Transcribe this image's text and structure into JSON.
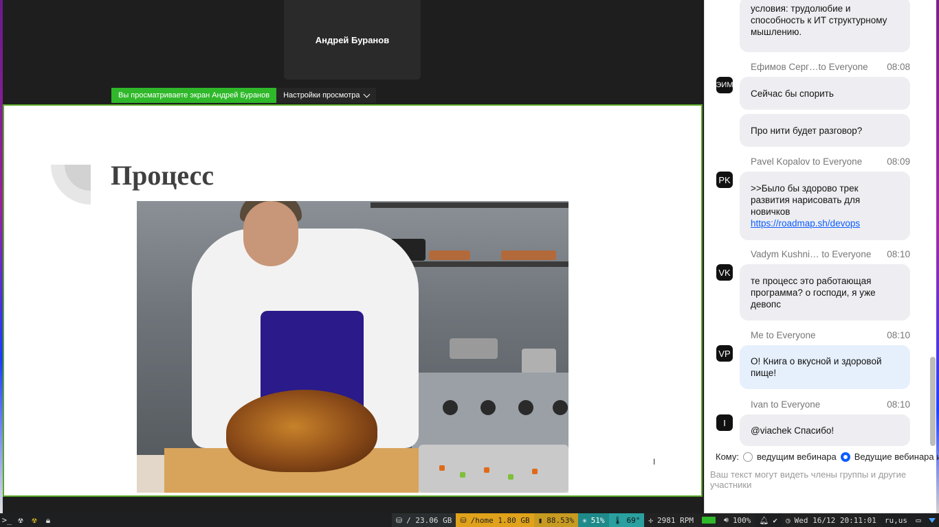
{
  "meeting": {
    "speaker_name": "Андрей Буранов",
    "share_label": "Вы просматриваете экран Андрей Буранов",
    "view_settings_label": "Настройки просмотра"
  },
  "slide": {
    "title": "Процесс"
  },
  "chat": {
    "partial_message": "условия: трудолюбие и способность к ИТ структурному мышлению.",
    "messages": [
      {
        "sender": "Ефимов Серг…to Everyone",
        "time": "08:08",
        "avatar": "ЭИМ",
        "bubbles": [
          "Сейчас бы спорить",
          "Про нити будет разговор?"
        ]
      },
      {
        "sender": "Pavel Kopalov to Everyone",
        "time": "08:09",
        "avatar": "PK",
        "text": ">>Было бы здорово трек развития нарисовать для новичков ",
        "link": "https://roadmap.sh/devops"
      },
      {
        "sender": "Vadym Kushni… to Everyone",
        "time": "08:10",
        "avatar": "VK",
        "text": "те процесс это работающая программа? о господи, я уже девопс"
      },
      {
        "sender": "Me to Everyone",
        "time": "08:10",
        "avatar": "VP",
        "text": "О! Книга о вкусной и здоровой пище!"
      },
      {
        "sender": "Ivan to Everyone",
        "time": "08:10",
        "avatar": "I",
        "text": "@viachek Спасибо!"
      }
    ],
    "to_label": "Кому:",
    "recipient_option_1": "ведущим вебинара",
    "recipient_option_2": "Ведущие вебинара и",
    "selected_recipient": "Ведущие вебинара и",
    "input_placeholder": "Ваш текст могут видеть члены группы и другие участники"
  },
  "taskbar": {
    "disk_root": "/ 23.06 GB",
    "disk_home": "/home 1.80 GB",
    "battery": "88.53%",
    "cpu": "51%",
    "temperature": "69°",
    "fan": "2981 RPM",
    "volume": "100%",
    "clock": "Wed 16/12 20:11:01",
    "keyboard_layout": "ru,us"
  },
  "colors": {
    "share_green": "#2fb82a",
    "link_blue": "#0b5cff",
    "apron": "#2a1a8a"
  }
}
